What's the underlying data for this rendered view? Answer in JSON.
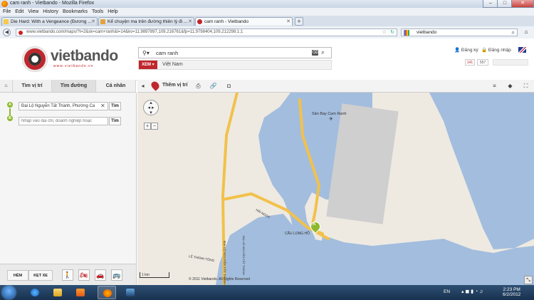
{
  "window": {
    "title": "cam ranh - Vietbando - Mozilla Firefox",
    "min": "–",
    "max": "□",
    "close": "✕"
  },
  "menu": [
    "File",
    "Edit",
    "View",
    "History",
    "Bookmarks",
    "Tools",
    "Help"
  ],
  "tabs": [
    {
      "label": "Die Hard: With a Vengeance (Đương ...",
      "close": "✕"
    },
    {
      "label": "Kể chuyện ma trên đường thiên lý đi ...",
      "close": "✕"
    },
    {
      "label": "cam ranh - Vietbando",
      "close": "✕"
    }
  ],
  "newtab": "+",
  "nav": {
    "url": "www.vietbando.com/maps/?t=2&sk=cam+ranh&l=14&kv=11.9897897,109.216761&fp=11.9798404,109.212298;1;1",
    "search_value": "vietbando",
    "back": "◀",
    "fwd": "▶"
  },
  "site": {
    "brand": "vietbando",
    "brand_sub": "www.vietbando.vn",
    "search_value": "cam ranh",
    "xem_label": "XEM",
    "country": "Việt Nam",
    "register": "Đăng ký",
    "login": "Đăng nhập",
    "counter_a": "141",
    "counter_b": "557"
  },
  "left_tabs": {
    "home": "⌂",
    "find_place": "Tìm vị trí",
    "find_route": "Tìm đường",
    "personal": "Cá nhân"
  },
  "route": {
    "from_value": "Đại Lộ Nguyễn Tất Thành, Phường Ca",
    "to_placeholder": "Nhập vào địa chỉ, doanh nghiệp hoặc",
    "find_label": "Tìm",
    "marker_a": "A",
    "marker_b": "B"
  },
  "bottom": {
    "alley": "HẺM",
    "traffic": "KẸT XE"
  },
  "map_toolbar": {
    "add_location": "Thêm vị trí"
  },
  "map": {
    "labels": {
      "airport": "Sân Bay Cam Ranh",
      "bridge": "CẦU LONG HỒ",
      "road_a": "ĐẠI LỘ NGUYỄN TẤT THÀNH",
      "road_b": "HẢI NGỌC",
      "road_c": "LÊ THÁNH TÔNG",
      "road_d": "ĐẠI LỘ NGUYỄN TẤT THÀNH"
    },
    "scale": "1 km",
    "copyright": "© 2011 Vietbando. All Rights Reserved",
    "marker": "A",
    "zoom_in": "+",
    "zoom_out": "−",
    "colors": {
      "water": "#a3bdde",
      "land": "#eeeae2",
      "road": "#f2c14b",
      "airport": "#cfcfcf"
    }
  },
  "taskbar": {
    "lang": "EN",
    "time": "2:23 PM",
    "date": "6/2/2012"
  }
}
